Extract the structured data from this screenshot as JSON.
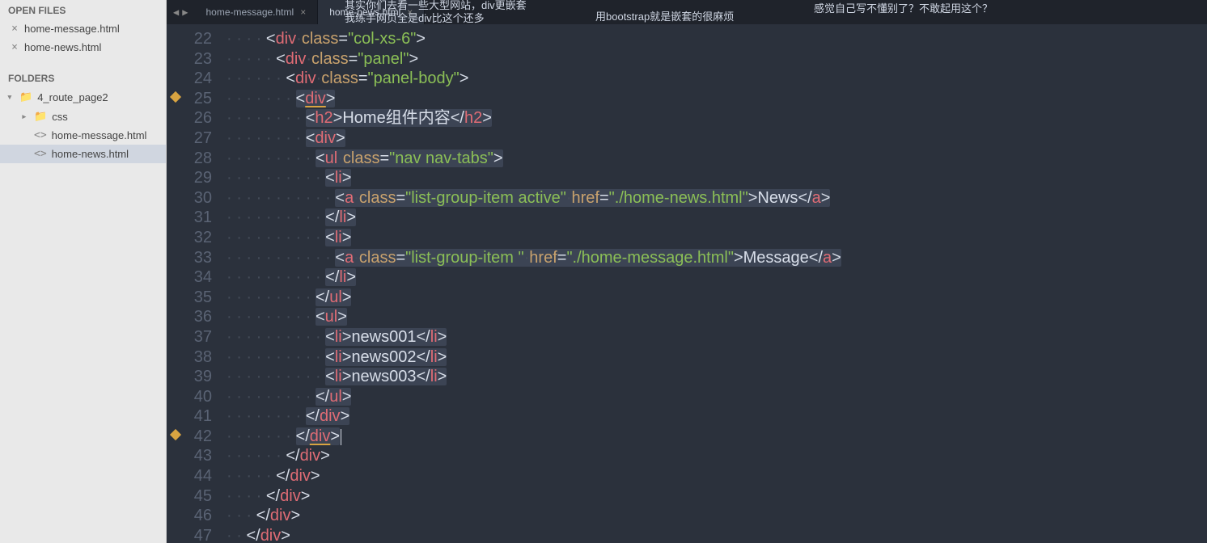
{
  "sidebar": {
    "open_files_header": "OPEN FILES",
    "open_files": [
      {
        "close": "×",
        "name": "home-message.html"
      },
      {
        "close": "×",
        "name": "home-news.html"
      }
    ],
    "folders_header": "FOLDERS",
    "tree": {
      "root_caret": "▾",
      "root_icon": "📁",
      "root": "4_route_page2",
      "items": [
        {
          "caret": "▸",
          "icon": "📁",
          "name": "css",
          "indent": "indent1"
        },
        {
          "caret": "",
          "icon": "<>",
          "name": "home-message.html",
          "indent": "indent1"
        },
        {
          "caret": "",
          "icon": "<>",
          "name": "home-news.html",
          "indent": "indent1",
          "sel": true
        }
      ]
    }
  },
  "tabs": {
    "nav_left": "◀",
    "nav_right": "▶",
    "items": [
      {
        "label": "home-message.html",
        "close": "×",
        "active": false
      },
      {
        "label": "home-news.html",
        "close": "×",
        "active": true
      }
    ]
  },
  "overlays": {
    "t1": "其实你们去看一些大型网站，div更嵌套",
    "t2": "我练手网页全是div比这个还多",
    "t3": "用bootstrap就是嵌套的很麻烦",
    "t4": "感觉自己写不懂别了？不敢起用这个？"
  },
  "gutter": {
    "start": 22,
    "end": 47,
    "marks": [
      25,
      42
    ]
  },
  "code": {
    "lines": [
      {
        "html": "<span class='ws'>· · · · </span><span class='tag-ang'>&lt;</span><span class='tag-name'>div</span><span class='ws'>·</span><span class='attr-name'>class</span><span class='tag-ang'>=</span><span class='attr-val'>\"col-xs-6\"</span><span class='tag-ang'>&gt;</span>"
      },
      {
        "html": "<span class='ws'>· · · · · </span><span class='tag-ang'>&lt;</span><span class='tag-name'>div</span><span class='ws'>·</span><span class='attr-name'>class</span><span class='tag-ang'>=</span><span class='attr-val'>\"panel\"</span><span class='tag-ang'>&gt;</span>"
      },
      {
        "html": "<span class='ws'>· · · · · · </span><span class='tag-ang'>&lt;</span><span class='tag-name'>div</span><span class='ws'>·</span><span class='attr-name'>class</span><span class='tag-ang'>=</span><span class='attr-val'>\"panel-body\"</span><span class='tag-ang'>&gt;</span>"
      },
      {
        "html": "<span class='ws'>· · · · · · · </span><span class='sel-bg'><span class='tag-ang'>&lt;</span><span class='tag-name outline'>div</span><span class='tag-ang'>&gt;</span></span>"
      },
      {
        "html": "<span class='ws'>· · · · · · · · </span><span class='sel-bg'><span class='tag-ang'>&lt;</span><span class='tag-name'>h2</span><span class='tag-ang'>&gt;</span><span class='text'>Home组件内容</span><span class='tag-ang'>&lt;/</span><span class='tag-name'>h2</span><span class='tag-ang'>&gt;</span></span>"
      },
      {
        "html": "<span class='ws'>· · · · · · · · </span><span class='sel-bg'><span class='tag-ang'>&lt;</span><span class='tag-name'>div</span><span class='tag-ang'>&gt;</span></span>"
      },
      {
        "html": "<span class='ws'>· · · · · · · · · </span><span class='sel-bg'><span class='tag-ang'>&lt;</span><span class='tag-name'>ul</span><span class='ws'>·</span><span class='attr-name'>class</span><span class='tag-ang'>=</span><span class='attr-val'>\"nav nav-tabs\"</span><span class='tag-ang'>&gt;</span></span>"
      },
      {
        "html": "<span class='ws'>· · · · · · · · · · </span><span class='sel-bg'><span class='tag-ang'>&lt;</span><span class='tag-name'>li</span><span class='tag-ang'>&gt;</span></span>"
      },
      {
        "html": "<span class='ws'>· · · · · · · · · · · </span><span class='sel-bg'><span class='tag-ang'>&lt;</span><span class='tag-name'>a</span><span class='ws'>·</span><span class='attr-name'>class</span><span class='tag-ang'>=</span><span class='attr-val'>\"list-group-item active\"</span><span class='ws'>·</span><span class='attr-name'>href</span><span class='tag-ang'>=</span><span class='attr-val'>\"./home-news.html\"</span><span class='tag-ang'>&gt;</span><span class='text'>News</span><span class='tag-ang'>&lt;/</span><span class='tag-name'>a</span><span class='tag-ang'>&gt;</span></span>"
      },
      {
        "html": "<span class='ws'>· · · · · · · · · · </span><span class='sel-bg'><span class='tag-ang'>&lt;/</span><span class='tag-name'>li</span><span class='tag-ang'>&gt;</span></span>"
      },
      {
        "html": "<span class='ws'>· · · · · · · · · · </span><span class='sel-bg'><span class='tag-ang'>&lt;</span><span class='tag-name'>li</span><span class='tag-ang'>&gt;</span></span>"
      },
      {
        "html": "<span class='ws'>· · · · · · · · · · · </span><span class='sel-bg'><span class='tag-ang'>&lt;</span><span class='tag-name'>a</span><span class='ws'>·</span><span class='attr-name'>class</span><span class='tag-ang'>=</span><span class='attr-val'>\"list-group-item \"</span><span class='ws'>·</span><span class='attr-name'>href</span><span class='tag-ang'>=</span><span class='attr-val'>\"./home-message.html\"</span><span class='tag-ang'>&gt;</span><span class='text'>Message</span><span class='tag-ang'>&lt;/</span><span class='tag-name'>a</span><span class='tag-ang'>&gt;</span></span>"
      },
      {
        "html": "<span class='ws'>· · · · · · · · · · </span><span class='sel-bg'><span class='tag-ang'>&lt;/</span><span class='tag-name'>li</span><span class='tag-ang'>&gt;</span></span>"
      },
      {
        "html": "<span class='ws'>· · · · · · · · · </span><span class='sel-bg'><span class='tag-ang'>&lt;/</span><span class='tag-name'>ul</span><span class='tag-ang'>&gt;</span></span>"
      },
      {
        "html": "<span class='ws'>· · · · · · · · · </span><span class='sel-bg'><span class='tag-ang'>&lt;</span><span class='tag-name'>ul</span><span class='tag-ang'>&gt;</span></span>"
      },
      {
        "html": "<span class='ws'>· · · · · · · · · · </span><span class='sel-bg'><span class='tag-ang'>&lt;</span><span class='tag-name'>li</span><span class='tag-ang'>&gt;</span><span class='text'>news001</span><span class='tag-ang'>&lt;/</span><span class='tag-name'>li</span><span class='tag-ang'>&gt;</span></span>"
      },
      {
        "html": "<span class='ws'>· · · · · · · · · · </span><span class='sel-bg'><span class='tag-ang'>&lt;</span><span class='tag-name'>li</span><span class='tag-ang'>&gt;</span><span class='text'>news002</span><span class='tag-ang'>&lt;/</span><span class='tag-name'>li</span><span class='tag-ang'>&gt;</span></span>"
      },
      {
        "html": "<span class='ws'>· · · · · · · · · · </span><span class='sel-bg'><span class='tag-ang'>&lt;</span><span class='tag-name'>li</span><span class='tag-ang'>&gt;</span><span class='text'>news003</span><span class='tag-ang'>&lt;/</span><span class='tag-name'>li</span><span class='tag-ang'>&gt;</span></span>"
      },
      {
        "html": "<span class='ws'>· · · · · · · · · </span><span class='sel-bg'><span class='tag-ang'>&lt;/</span><span class='tag-name'>ul</span><span class='tag-ang'>&gt;</span></span>"
      },
      {
        "html": "<span class='ws'>· · · · · · · · </span><span class='sel-bg'><span class='tag-ang'>&lt;/</span><span class='tag-name'>div</span><span class='tag-ang'>&gt;</span></span>"
      },
      {
        "html": "<span class='ws'>· · · · · · · </span><span class='sel-bg'><span class='tag-ang'>&lt;/</span><span class='tag-name outline'>div</span><span class='tag-ang'>&gt;</span></span><span class='cursor'></span>"
      },
      {
        "html": "<span class='ws'>· · · · · · </span><span class='tag-ang'>&lt;/</span><span class='tag-name'>div</span><span class='tag-ang'>&gt;</span>"
      },
      {
        "html": "<span class='ws'>· · · · · </span><span class='tag-ang'>&lt;/</span><span class='tag-name'>div</span><span class='tag-ang'>&gt;</span>"
      },
      {
        "html": "<span class='ws'>· · · · </span><span class='tag-ang'>&lt;/</span><span class='tag-name'>div</span><span class='tag-ang'>&gt;</span>"
      },
      {
        "html": "<span class='ws'>· · · </span><span class='tag-ang'>&lt;/</span><span class='tag-name'>div</span><span class='tag-ang'>&gt;</span>"
      },
      {
        "html": "<span class='ws'>· · </span><span class='tag-ang'>&lt;/</span><span class='tag-name'>div</span><span class='tag-ang'>&gt;</span>"
      }
    ]
  }
}
